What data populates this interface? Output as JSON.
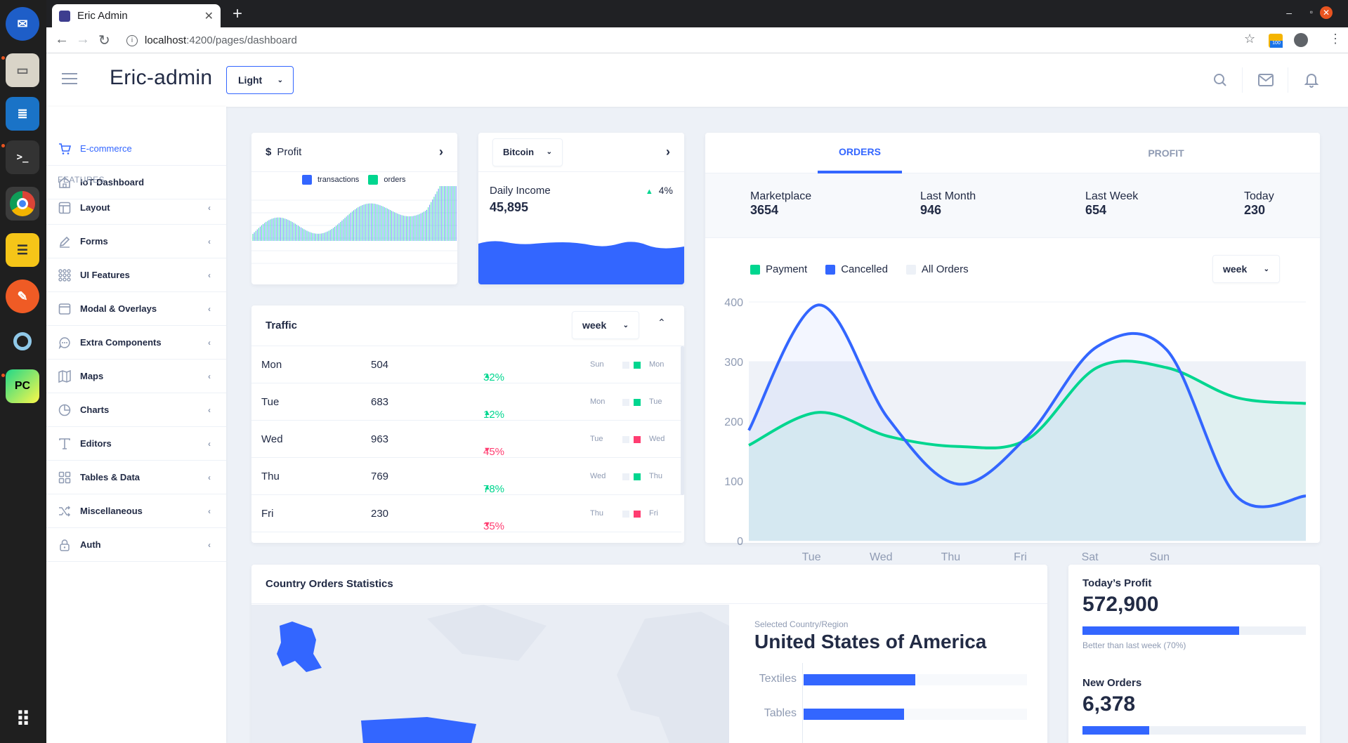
{
  "browser": {
    "tab_title": "Eric Admin",
    "url_host": "localhost",
    "url_path": ":4200/pages/dashboard"
  },
  "dock": {
    "apps": [
      "thunderbird-icon",
      "files-icon",
      "writer-icon",
      "terminal-icon",
      "chrome-icon",
      "notes-icon",
      "postman-icon",
      "obs-icon",
      "pycharm-icon",
      "app-grid-icon"
    ]
  },
  "header": {
    "brand": "Eric-admin",
    "theme": "Light"
  },
  "sidebar": {
    "items": [
      {
        "label": "E-commerce",
        "icon": "cart-icon"
      },
      {
        "label": "IoT Dashboard",
        "icon": "home-icon"
      }
    ],
    "group_label": "FEATURES",
    "features": [
      {
        "label": "Layout",
        "icon": "layout-icon"
      },
      {
        "label": "Forms",
        "icon": "edit-icon"
      },
      {
        "label": "UI Features",
        "icon": "keypad-icon"
      },
      {
        "label": "Modal & Overlays",
        "icon": "browser-icon"
      },
      {
        "label": "Extra Components",
        "icon": "message-icon"
      },
      {
        "label": "Maps",
        "icon": "map-icon"
      },
      {
        "label": "Charts",
        "icon": "pie-chart-icon"
      },
      {
        "label": "Editors",
        "icon": "text-icon"
      },
      {
        "label": "Tables & Data",
        "icon": "grid-icon"
      },
      {
        "label": "Miscellaneous",
        "icon": "shuffle-icon"
      },
      {
        "label": "Auth",
        "icon": "lock-icon"
      }
    ]
  },
  "profit_card": {
    "currency": "$",
    "title": "Profit",
    "legend_transactions": "transactions",
    "legend_orders": "orders"
  },
  "bitcoin_card": {
    "select": "Bitcoin",
    "label": "Daily Income",
    "value": "45,895",
    "delta": "4%"
  },
  "traffic": {
    "title": "Traffic",
    "period": "week",
    "rows": [
      {
        "day": "Mon",
        "value": "504",
        "delta": "32%",
        "dir": "up",
        "prev": "Sun",
        "cur": "Mon"
      },
      {
        "day": "Tue",
        "value": "683",
        "delta": "12%",
        "dir": "up",
        "prev": "Mon",
        "cur": "Tue"
      },
      {
        "day": "Wed",
        "value": "963",
        "delta": "45%",
        "dir": "down",
        "prev": "Tue",
        "cur": "Wed"
      },
      {
        "day": "Thu",
        "value": "769",
        "delta": "78%",
        "dir": "up",
        "prev": "Wed",
        "cur": "Thu"
      },
      {
        "day": "Fri",
        "value": "230",
        "delta": "35%",
        "dir": "down",
        "prev": "Thu",
        "cur": "Fri"
      }
    ]
  },
  "orders_card": {
    "tab_orders": "ORDERS",
    "tab_profit": "PROFIT",
    "stats": [
      {
        "label": "Marketplace",
        "value": "3654"
      },
      {
        "label": "Last Month",
        "value": "946"
      },
      {
        "label": "Last Week",
        "value": "654"
      },
      {
        "label": "Today",
        "value": "230"
      }
    ],
    "legend": [
      {
        "label": "Payment",
        "color": "#00d68f"
      },
      {
        "label": "Cancelled",
        "color": "#3366ff"
      },
      {
        "label": "All Orders",
        "color": "#edf1f7"
      }
    ],
    "period": "week"
  },
  "chart_data": {
    "type": "line",
    "title": "",
    "xlabel": "",
    "ylabel": "",
    "ylim": [
      0,
      400
    ],
    "yticks": [
      "400",
      "300",
      "200",
      "100",
      "0"
    ],
    "categories": [
      "Tue",
      "Wed",
      "Thu",
      "Fri",
      "Sat",
      "Sun"
    ],
    "x": [
      0,
      1,
      2,
      3,
      4,
      5,
      6,
      7,
      8
    ],
    "series": [
      {
        "name": "Payment",
        "color": "#00d68f",
        "values": [
          160,
          215,
          175,
          158,
          170,
          290,
          290,
          240,
          230
        ]
      },
      {
        "name": "Cancelled",
        "color": "#3366ff",
        "values": [
          185,
          395,
          205,
          95,
          175,
          325,
          320,
          75,
          75
        ]
      },
      {
        "name": "All Orders",
        "color": "#edf1f7",
        "values": [
          300,
          300,
          300,
          300,
          300,
          300,
          300,
          300,
          300
        ]
      }
    ]
  },
  "country_card": {
    "title": "Country Orders Statistics",
    "caption": "Selected Country/Region",
    "country": "United States of America",
    "bars": [
      {
        "label": "Textiles",
        "value": 50
      },
      {
        "label": "Tables",
        "value": 45
      }
    ]
  },
  "profit_summary": {
    "profit_label": "Today’s Profit",
    "profit_value": "572,900",
    "profit_progress": 70,
    "profit_caption": "Better than last week (70%)",
    "orders_label": "New Orders",
    "orders_value": "6,378",
    "orders_progress": 30
  }
}
